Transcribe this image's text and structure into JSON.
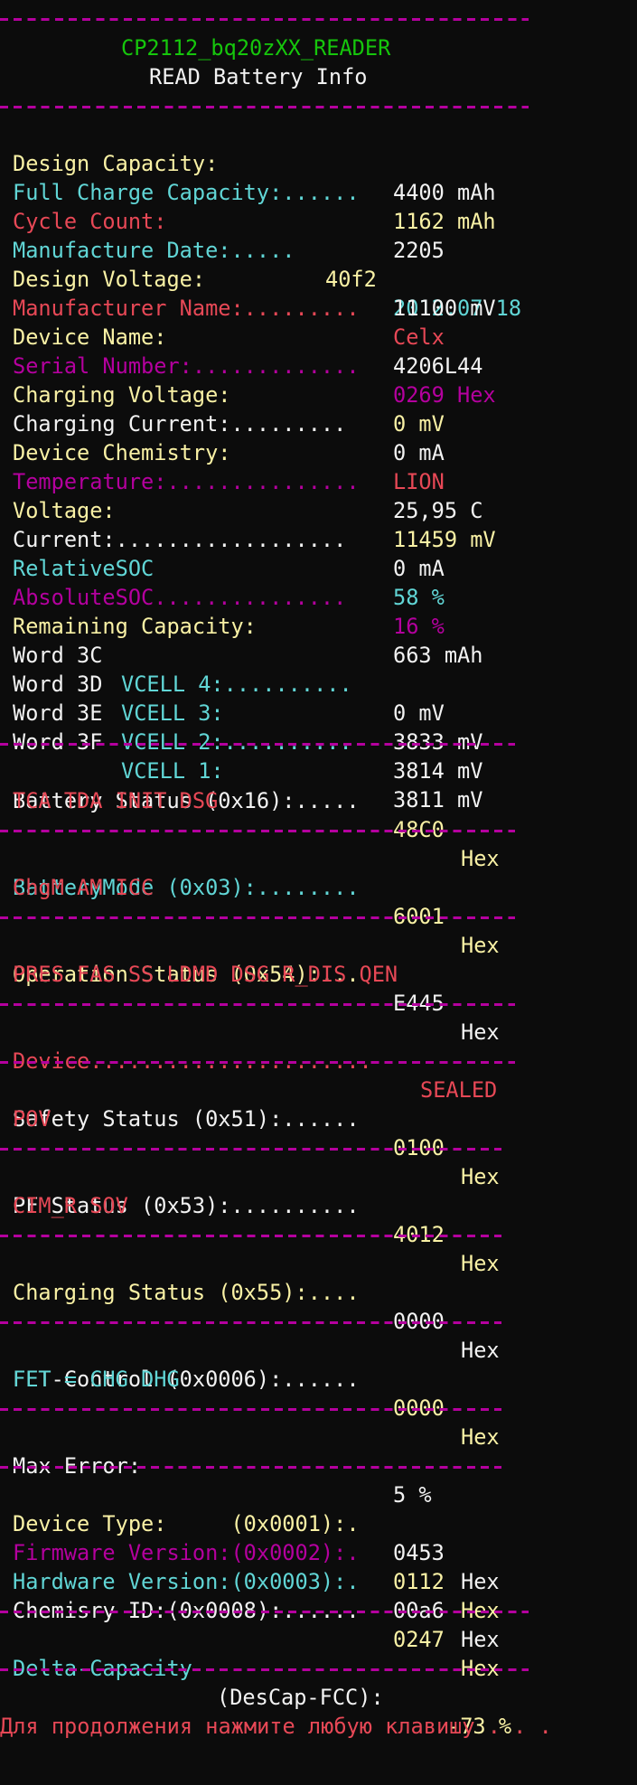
{
  "colors": {
    "background": "#0c0c0c",
    "yellow": "#f9f1a5",
    "cyan": "#61d6d6",
    "red": "#e74856",
    "magenta": "#b4009e",
    "white": "#f2f2f2",
    "green": "#16c60c"
  },
  "title": "CP2112_bq20zXX_READER",
  "subtitle": "READ Battery Info",
  "rows": {
    "design_capacity": {
      "label": "Design Capacity:",
      "value": "4400 mAh"
    },
    "full_charge": {
      "label": "Full Charge Capacity:......",
      "value": "1162 mAh"
    },
    "cycle_count": {
      "label": "Cycle Count:",
      "value": "2205"
    },
    "manufacture_date": {
      "label": "Manufacture Date:.....",
      "raw": "40f2",
      "value": "2012.07.18"
    },
    "design_voltage": {
      "label": "Design Voltage:",
      "value": "11100 mV"
    },
    "manufacturer_name": {
      "label": "Manufacturer Name:.........",
      "value": "Celx"
    },
    "device_name": {
      "label": "Device Name:",
      "value": "4206L44"
    },
    "serial_number": {
      "label": "Serial Number:.............",
      "value": "0269 Hex"
    },
    "charging_voltage": {
      "label": "Charging Voltage:",
      "value": "0 mV"
    },
    "charging_current": {
      "label": "Charging Current:.........",
      "value": "0 mA"
    },
    "device_chemistry": {
      "label": "Device Chemistry:",
      "value": "LION"
    },
    "temperature": {
      "label": "Temperature:...............",
      "value": "25,95 C"
    },
    "voltage": {
      "label": "Voltage:",
      "value": "11459 mV"
    },
    "current": {
      "label": "Current:..................",
      "value": "0 mA"
    },
    "relative_soc": {
      "label": "RelativeSOC",
      "value": "58 %"
    },
    "absolute_soc": {
      "label": "AbsoluteSOC...............",
      "value": "16 %"
    },
    "remaining_capacity": {
      "label": "Remaining Capacity:",
      "value": "663 mAh"
    },
    "word_3c": {
      "word": "Word 3C",
      "cell": "VCELL 4:..........",
      "value": "0 mV"
    },
    "word_3d": {
      "word": "Word 3D",
      "cell": "VCELL 3:",
      "value": "3833 mV"
    },
    "word_3e": {
      "word": "Word 3E",
      "cell": "VCELL 2:..........",
      "value": "3814 mV"
    },
    "word_3f": {
      "word": "Word 3F",
      "cell": "VCELL 1:",
      "value": "3811 mV"
    }
  },
  "battery_status": {
    "label": "Battery Status (0x16):.....",
    "value": "48C0",
    "unit": "Hex",
    "flags": "TCA TDA INIT DSG"
  },
  "battery_mode": {
    "label": "BatteryMode (0x03):........",
    "value": "6001",
    "unit": "Hex",
    "flags": "ChgM AM ICC"
  },
  "operation_status": {
    "label": "Operation Status (0x54):...",
    "value": "E445",
    "unit": "Hex",
    "flags": "PRES FAS SS LDMD DSG R_DIS QEN"
  },
  "device_state": {
    "label": "Device......................",
    "value": "SEALED"
  },
  "safety_status": {
    "label": "Safety Status (0x51):......",
    "value": "0100",
    "unit": "Hex",
    "flags": "POV"
  },
  "pf_status": {
    "label": "PF Status (0x53):..........",
    "value": "4012",
    "unit": "Hex",
    "flags": "CIM_R SOV"
  },
  "charging_status": {
    "label": "Charging Status (0x55):....",
    "value": "0000",
    "unit": "Hex"
  },
  "fet_control": {
    "label": "FET-Control (0x0006):......",
    "value": "0000",
    "unit": "Hex",
    "flags": "FET = CHG DHG"
  },
  "max_error": {
    "label": "Max Error:",
    "value": "5 %"
  },
  "versions": {
    "device_type": {
      "label": "Device Type:     (0x0001):.",
      "value": "0453",
      "unit": "Hex"
    },
    "firmware_version": {
      "label": "Firmware Version:(0x0002):.",
      "value": "0112",
      "unit": "Hex"
    },
    "hardware_version": {
      "label": "Hardware Version:(0x0003):.",
      "value": "00a6",
      "unit": "Hex"
    },
    "chemistry_id": {
      "label": "Chemisry ID:(0x0008):......",
      "value": "0247",
      "unit": "Hex"
    }
  },
  "delta_capacity": {
    "label": "Delta-Capacity",
    "formula": "(DesCap-FCC):",
    "value": "-73 %"
  },
  "prompt": "Для продолжения нажмите любую клавишу . . ."
}
